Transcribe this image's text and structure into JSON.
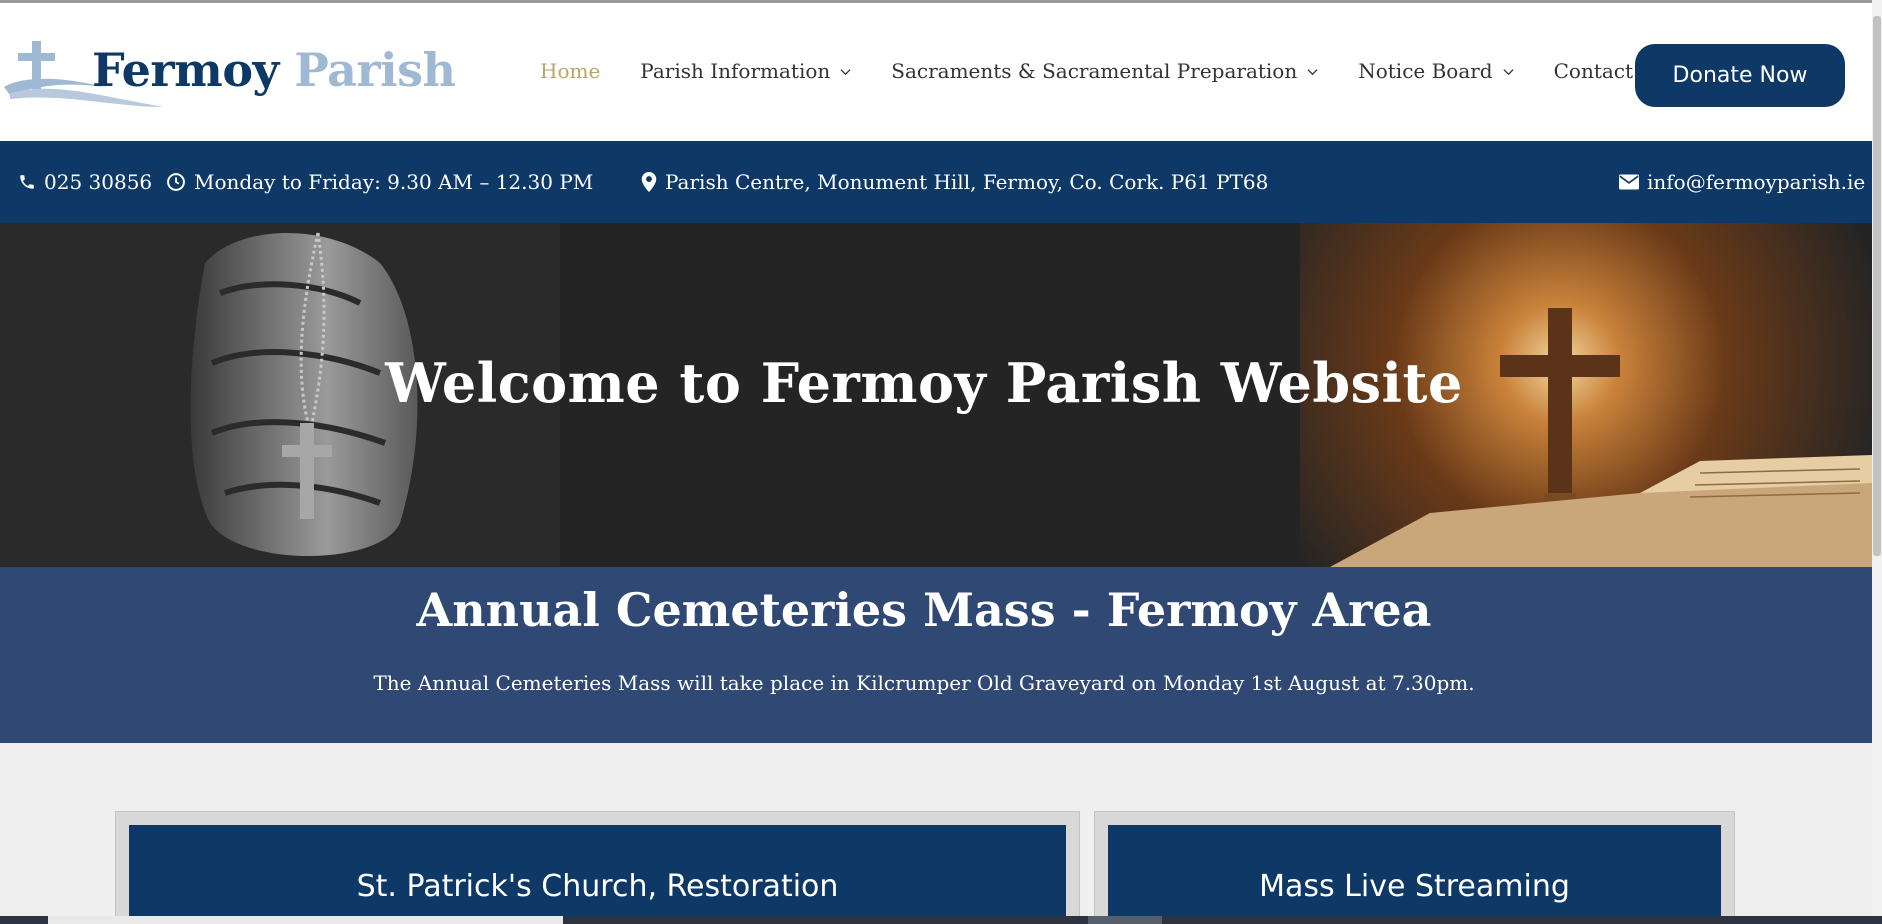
{
  "header": {
    "logo": {
      "word1": "Fermoy",
      "word2": "Parish"
    },
    "nav": [
      {
        "label": "Home",
        "active": true,
        "dropdown": false
      },
      {
        "label": "Parish Information",
        "active": false,
        "dropdown": true
      },
      {
        "label": "Sacraments & Sacramental Preparation",
        "active": false,
        "dropdown": true
      },
      {
        "label": "Notice Board",
        "active": false,
        "dropdown": true
      },
      {
        "label": "Contact",
        "active": false,
        "dropdown": false
      }
    ],
    "donate_label": "Donate Now"
  },
  "infobar": {
    "phone": "025 30856",
    "hours": "Monday to Friday: 9.30 AM – 12.30 PM",
    "address": "Parish Centre, Monument Hill, Fermoy, Co. Cork. P61 PT68",
    "email": "info@fermoyparish.ie"
  },
  "hero": {
    "title": "Welcome to Fermoy Parish Website"
  },
  "announcement": {
    "title": "Annual Cemeteries Mass - Fermoy Area",
    "text": "The Annual Cemeteries Mass will take place in Kilcrumper Old Graveyard on Monday 1st August at 7.30pm."
  },
  "cards": [
    {
      "title": "St. Patrick's Church, Restoration"
    },
    {
      "title": "Mass Live Streaming"
    }
  ],
  "colors": {
    "brand_navy": "#0e3866",
    "logo_light": "#9fb8d4",
    "nav_active": "#b9a56b",
    "announcement_bg": "#304874"
  },
  "icons": [
    "phone-icon",
    "clock-icon",
    "map-marker-icon",
    "envelope-icon",
    "chevron-down-icon",
    "cross-icon"
  ]
}
